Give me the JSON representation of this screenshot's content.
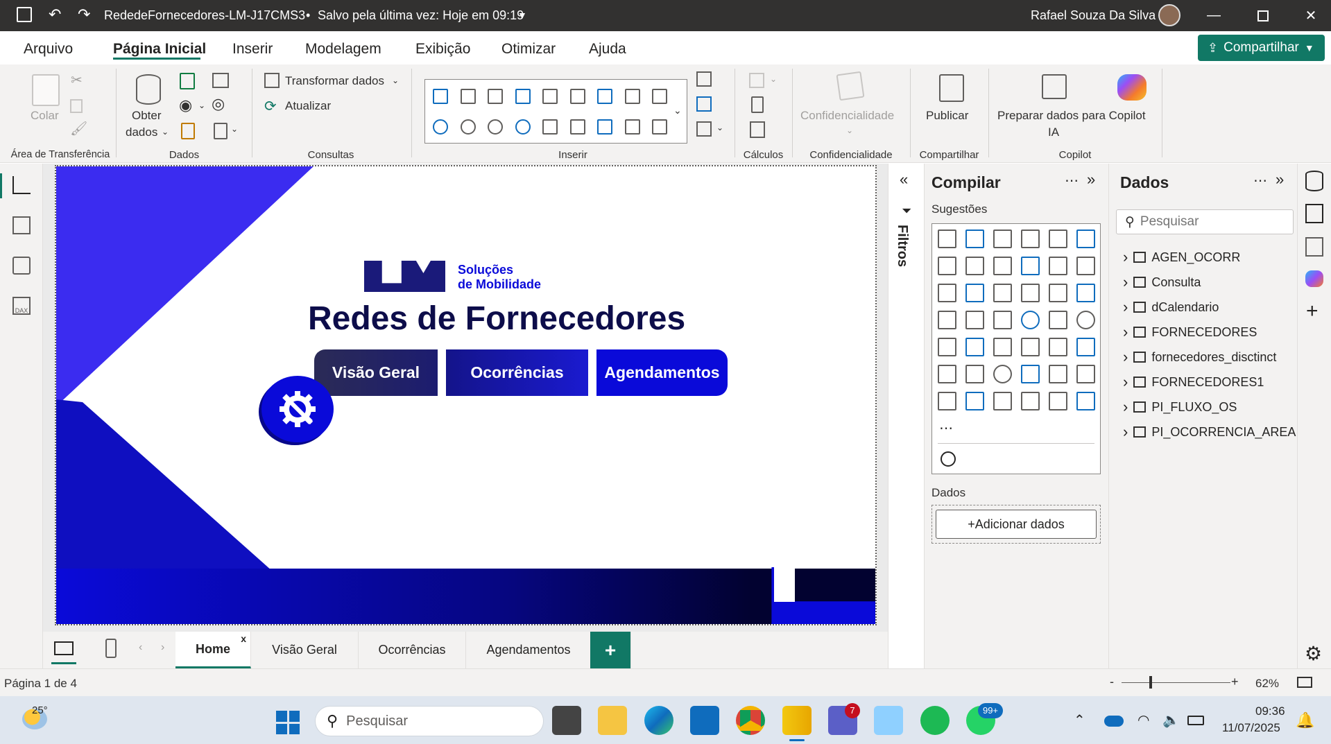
{
  "titlebar": {
    "doc_title": "RededeFornecedores-LM-J17CMS3",
    "save_status": "Salvo pela última vez: Hoje em 09:19",
    "user_name": "Rafael Souza Da Silva"
  },
  "menu": {
    "items": [
      "Arquivo",
      "Página Inicial",
      "Inserir",
      "Modelagem",
      "Exibição",
      "Otimizar",
      "Ajuda"
    ],
    "active": "Página Inicial",
    "share_label": "Compartilhar"
  },
  "ribbon": {
    "clipboard": {
      "paste": "Colar",
      "group": "Área de Transferência"
    },
    "data": {
      "get_data_line1": "Obter",
      "get_data_line2": "dados",
      "group": "Dados"
    },
    "queries": {
      "transform": "Transformar dados",
      "refresh": "Atualizar",
      "group": "Consultas"
    },
    "insert": {
      "group": "Inserir"
    },
    "calc": {
      "group": "Cálculos"
    },
    "sensitivity": {
      "label": "Confidencialidade",
      "group": "Confidencialidade"
    },
    "share": {
      "publish": "Publicar",
      "group": "Compartilhar"
    },
    "copilot": {
      "prepare_line1": "Preparar dados para Copilot",
      "prepare_line2": "IA",
      "group": "Copilot"
    }
  },
  "report": {
    "logo_line1": "Soluções",
    "logo_line2": "de Mobilidade",
    "title": "Redes de Fornecedores",
    "nav_buttons": [
      "Visão Geral",
      "Ocorrências",
      "Agendamentos"
    ],
    "colors": {
      "primary": "#0a0ad9",
      "dark": "#1a1a7a",
      "accent": "#3b2cf0"
    }
  },
  "filters": {
    "label": "Filtros"
  },
  "build_pane": {
    "title": "Compilar",
    "suggestions": "Sugestões",
    "data_label": "Dados",
    "add_data": "+Adicionar dados"
  },
  "data_pane": {
    "title": "Dados",
    "search_placeholder": "Pesquisar",
    "tables": [
      "AGEN_OCORR",
      "Consulta",
      "dCalendario",
      "FORNECEDORES",
      "fornecedores_disctinct",
      "FORNECEDORES1",
      "PI_FLUXO_OS",
      "PI_OCORRENCIA_AREA"
    ]
  },
  "tabs": {
    "pages": [
      "Home",
      "Visão Geral",
      "Ocorrências",
      "Agendamentos"
    ],
    "active": "Home",
    "add": "+"
  },
  "status": {
    "page_info": "Página 1 de 4",
    "zoom": "62%"
  },
  "taskbar": {
    "temperature": "25°",
    "search_placeholder": "Pesquisar",
    "time": "09:36",
    "date": "11/07/2025",
    "teams_badge": "7",
    "whatsapp_badge": "99+"
  }
}
